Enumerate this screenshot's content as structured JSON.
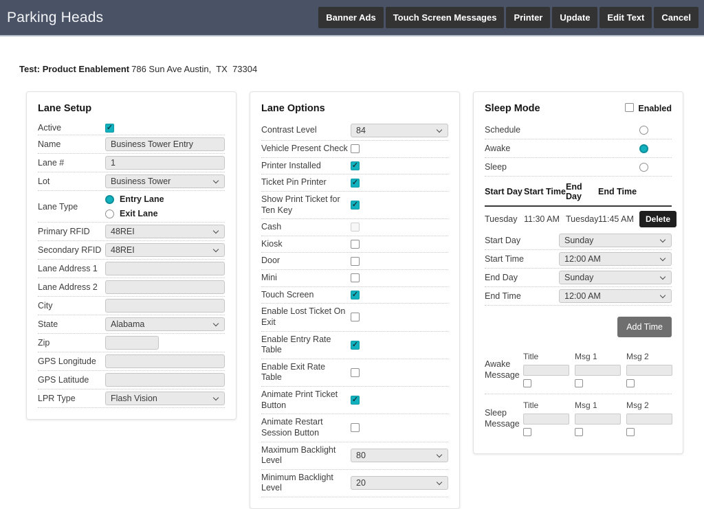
{
  "colors": {
    "accent": "#12b1be",
    "header_background": "#4a5365",
    "toolbar_button_background": "#333333",
    "delete_button_background": "#1f1f1f",
    "add_time_button_background": "#6f6f6f"
  },
  "header": {
    "title": "Parking Heads",
    "buttons": [
      "Banner Ads",
      "Touch Screen Messages",
      "Printer",
      "Update",
      "Edit Text",
      "Cancel"
    ]
  },
  "site": {
    "name": "Test: Product Enablement",
    "address": "786 Sun Ave Austin,  TX  73304"
  },
  "lane_setup": {
    "title": "Lane Setup",
    "rows": [
      {
        "label": "Active",
        "type": "checkbox",
        "checked": true
      },
      {
        "label": "Name",
        "type": "text",
        "value": "Business Tower Entry"
      },
      {
        "label": "Lane #",
        "type": "text",
        "value": "1"
      },
      {
        "label": "Lot",
        "type": "select",
        "value": "Business Tower"
      },
      {
        "label": "Lane Type",
        "type": "radio-group",
        "options": [
          {
            "label": "Entry Lane",
            "selected": true
          },
          {
            "label": "Exit Lane",
            "selected": false
          }
        ]
      },
      {
        "label": "Primary RFID",
        "type": "select",
        "value": "48REI"
      },
      {
        "label": "Secondary RFID",
        "type": "select",
        "value": "48REI"
      },
      {
        "label": "Lane Address 1",
        "type": "text",
        "value": ""
      },
      {
        "label": "Lane Address 2",
        "type": "text",
        "value": ""
      },
      {
        "label": "City",
        "type": "text",
        "value": ""
      },
      {
        "label": "State",
        "type": "select",
        "value": "Alabama"
      },
      {
        "label": "Zip",
        "type": "text",
        "value": "",
        "short": true
      },
      {
        "label": "GPS Longitude",
        "type": "text",
        "value": ""
      },
      {
        "label": "GPS Latitude",
        "type": "text",
        "value": ""
      },
      {
        "label": "LPR Type",
        "type": "select",
        "value": "Flash Vision"
      }
    ]
  },
  "lane_options": {
    "title": "Lane Options",
    "rows": [
      {
        "label": "Contrast Level",
        "type": "select",
        "value": "84"
      },
      {
        "label": "Vehicle Present Check",
        "type": "checkbox",
        "checked": false
      },
      {
        "label": "Printer Installed",
        "type": "checkbox",
        "checked": true
      },
      {
        "label": "Ticket Pin Printer",
        "type": "checkbox",
        "checked": true
      },
      {
        "label": "Show Print Ticket for Ten Key",
        "type": "checkbox",
        "checked": true
      },
      {
        "label": "Cash",
        "type": "checkbox",
        "checked": false,
        "disabled": true
      },
      {
        "label": "Kiosk",
        "type": "checkbox",
        "checked": false
      },
      {
        "label": "Door",
        "type": "checkbox",
        "checked": false
      },
      {
        "label": "Mini",
        "type": "checkbox",
        "checked": false
      },
      {
        "label": "Touch Screen",
        "type": "checkbox",
        "checked": true
      },
      {
        "label": "Enable Lost Ticket On Exit",
        "type": "checkbox",
        "checked": false
      },
      {
        "label": "Enable Entry Rate Table",
        "type": "checkbox",
        "checked": true
      },
      {
        "label": "Enable Exit Rate Table",
        "type": "checkbox",
        "checked": false
      },
      {
        "label": "Animate Print Ticket Button",
        "type": "checkbox",
        "checked": true
      },
      {
        "label": "Animate Restart Session Button",
        "type": "checkbox",
        "checked": false
      },
      {
        "label": "Maximum Backlight Level",
        "type": "select",
        "value": "80"
      },
      {
        "label": "Minimum Backlight Level",
        "type": "select",
        "value": "20"
      }
    ]
  },
  "sleep_mode": {
    "title": "Sleep Mode",
    "enabled_label": "Enabled",
    "enabled": false,
    "radios": [
      {
        "label": "Schedule",
        "selected": false
      },
      {
        "label": "Awake",
        "selected": true
      },
      {
        "label": "Sleep",
        "selected": false
      }
    ],
    "table": {
      "headers": [
        "Start Day",
        "Start Time",
        "End Day",
        "End Time"
      ],
      "rows": [
        [
          "Tuesday",
          "11:30 AM",
          "Tuesday",
          "11:45 AM"
        ]
      ],
      "delete_label": "Delete"
    },
    "fields": [
      {
        "label": "Start Day",
        "value": "Sunday"
      },
      {
        "label": "Start Time",
        "value": "12:00 AM"
      },
      {
        "label": "End Day",
        "value": "Sunday"
      },
      {
        "label": "End Time",
        "value": "12:00 AM"
      }
    ],
    "add_time_label": "Add Time",
    "messages": [
      {
        "label": "Awake Message",
        "columns": [
          "Title",
          "Msg 1",
          "Msg 2"
        ]
      },
      {
        "label": "Sleep Message",
        "columns": [
          "Title",
          "Msg 1",
          "Msg 2"
        ]
      }
    ]
  }
}
